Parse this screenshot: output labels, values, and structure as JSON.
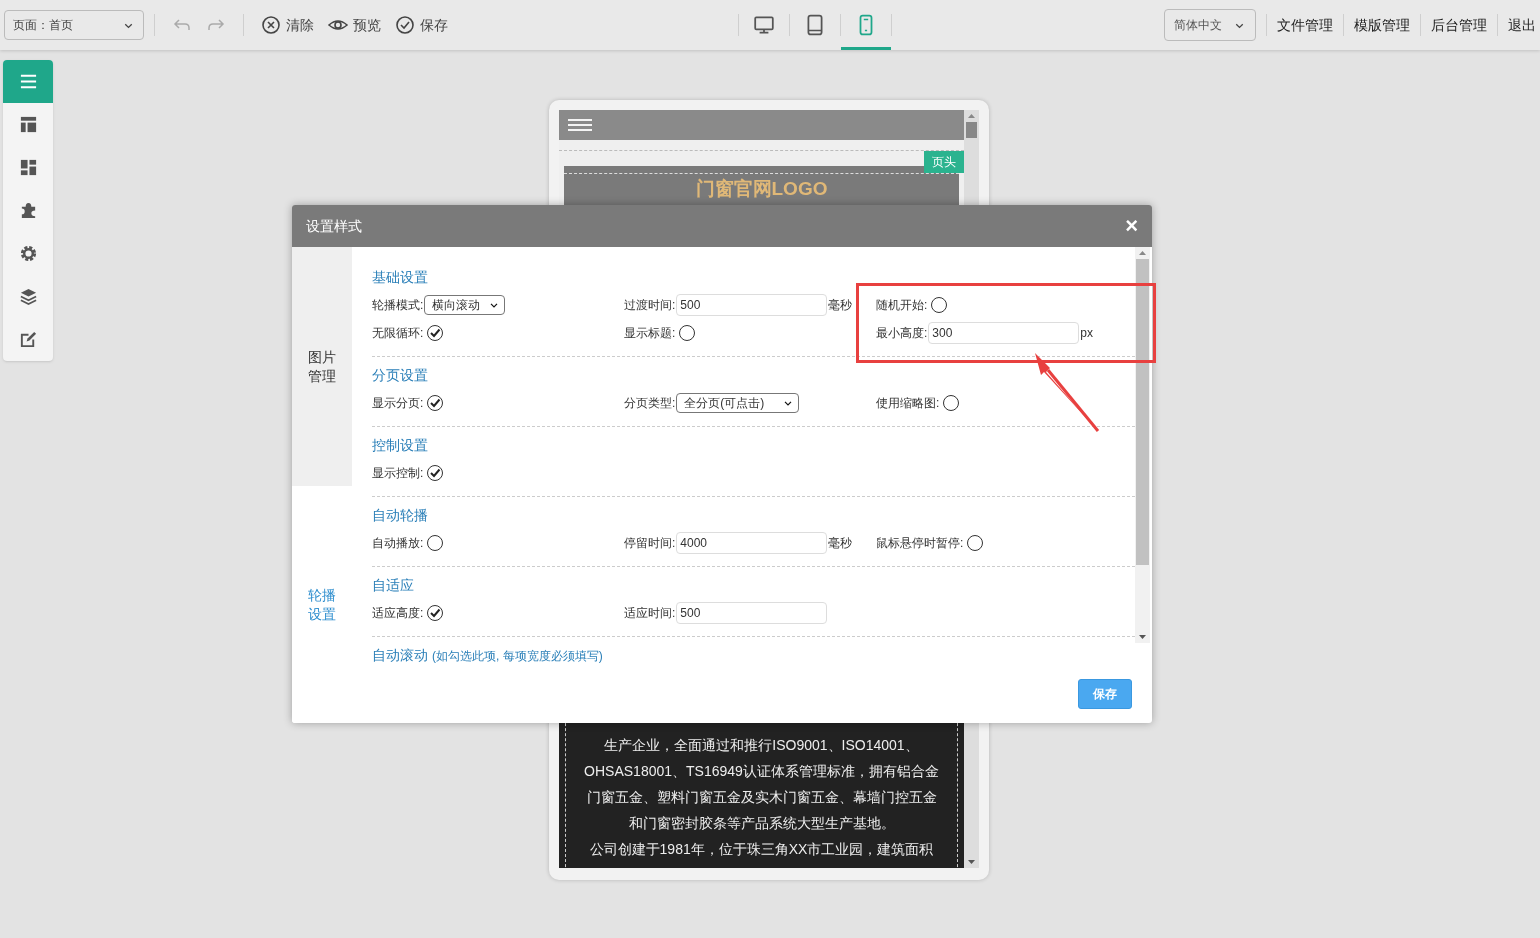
{
  "top_bar": {
    "page_select": "页面：首页",
    "actions": [
      {
        "kind": "undo",
        "disabled": true
      },
      {
        "kind": "redo",
        "disabled": true
      },
      {
        "kind": "clear",
        "label": "清除"
      },
      {
        "kind": "preview",
        "label": "预览"
      },
      {
        "kind": "save",
        "label": "保存"
      }
    ],
    "devices": [
      {
        "kind": "desktop",
        "selected": false
      },
      {
        "kind": "tablet",
        "selected": false
      },
      {
        "kind": "mobile",
        "selected": true
      }
    ],
    "language": "简体中文",
    "links": [
      "文件管理",
      "模版管理",
      "后台管理",
      "退出"
    ]
  },
  "side_toolbar": [
    {
      "kind": "menu",
      "selected": true
    },
    {
      "kind": "layout",
      "selected": false
    },
    {
      "kind": "dashboard",
      "selected": false
    },
    {
      "kind": "plugin",
      "selected": false
    },
    {
      "kind": "settings",
      "selected": false
    },
    {
      "kind": "layers",
      "selected": false
    },
    {
      "kind": "edit",
      "selected": false
    }
  ],
  "preview": {
    "badge": "页头",
    "logo": "门窗官网LOGO",
    "lines": [
      "生产企业，全面通过和推行ISO9001、ISO14001、",
      "OHSAS18001、TS16949认证体系管理标准，拥有铝合金",
      "门窗五金、塑料门窗五金及实木门窗五金、幕墙门控五金",
      "和门窗密封胶条等产品系统大型生产基地。",
      "公司创建于1981年，位于珠三角XX市工业园，建筑面积"
    ]
  },
  "dialog": {
    "title": "设置样式",
    "close": "×",
    "tabs": [
      {
        "label": "图片管理",
        "selected": false
      },
      {
        "label": "轮播设置",
        "selected": true
      }
    ],
    "sections": [
      {
        "title": "基础设置",
        "rows": [
          [
            {
              "kind": "select",
              "label": "轮播模式:",
              "value": "横向滚动"
            },
            {
              "kind": "input",
              "label": "过渡时间:",
              "value": "500",
              "unit": "毫秒"
            },
            {
              "kind": "toggle",
              "label": "随机开始:",
              "checked": false
            }
          ],
          [
            {
              "kind": "toggle",
              "label": "无限循环:",
              "checked": true
            },
            {
              "kind": "toggle",
              "label": "显示标题:",
              "checked": false
            },
            {
              "kind": "input",
              "label": "最小高度:",
              "value": "300",
              "unit": "px"
            }
          ]
        ]
      },
      {
        "title": "分页设置",
        "rows": [
          [
            {
              "kind": "toggle",
              "label": "显示分页:",
              "checked": true
            },
            {
              "kind": "select",
              "label": "分页类型:",
              "value": "全分页(可点击)"
            },
            {
              "kind": "toggle",
              "label": "使用缩略图:",
              "checked": false
            }
          ]
        ]
      },
      {
        "title": "控制设置",
        "rows": [
          [
            {
              "kind": "toggle",
              "label": "显示控制:",
              "checked": true
            }
          ]
        ]
      },
      {
        "title": "自动轮播",
        "rows": [
          [
            {
              "kind": "toggle",
              "label": "自动播放:",
              "checked": false
            },
            {
              "kind": "input",
              "label": "停留时间:",
              "value": "4000",
              "unit": "毫秒"
            },
            {
              "kind": "toggle",
              "label": "鼠标悬停时暂停:",
              "checked": false
            }
          ]
        ]
      },
      {
        "title": "自适应",
        "rows": [
          [
            {
              "kind": "toggle",
              "label": "适应高度:",
              "checked": true
            },
            {
              "kind": "input",
              "label": "适应时间:",
              "value": "500"
            }
          ]
        ]
      },
      {
        "title": "自动滚动",
        "note": "(如勾选此项, 每项宽度必须填写)"
      }
    ],
    "save": "保存"
  }
}
